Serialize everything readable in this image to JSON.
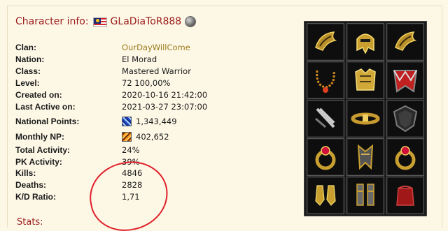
{
  "header": {
    "label": "Character info:",
    "name": "GLaDiaToR888"
  },
  "info": [
    {
      "key": "Clan:",
      "value": "OurDayWillCome",
      "link": true
    },
    {
      "key": "Nation:",
      "value": "El Morad"
    },
    {
      "key": "Class:",
      "value": "Mastered Warrior"
    },
    {
      "key": "Level:",
      "value": "72 100,00%"
    },
    {
      "key": "Created on:",
      "value": "2020-10-16 21:42:00"
    },
    {
      "key": "Last Active on:",
      "value": "2021-03-27 23:07:00"
    },
    {
      "key": "National Points:",
      "value": "1,343,449",
      "icon": "national-points-icon"
    },
    {
      "key": "Monthly NP:",
      "value": "402,652",
      "icon": "monthly-np-icon"
    },
    {
      "key": "Total Activity:",
      "value": "24%"
    },
    {
      "key": "PK Activity:",
      "value": "39%"
    },
    {
      "key": "Kills:",
      "value": "4846"
    },
    {
      "key": "Deaths:",
      "value": "2828"
    },
    {
      "key": "K/D Ratio:",
      "value": "1,71"
    }
  ],
  "stats_label": "Stats:",
  "colors": {
    "header_red": "#9a1a1a",
    "clan_link": "#9a7a1a",
    "annotation_red": "#e0202a",
    "background": "#fdf8e6"
  },
  "inventory": [
    "shoulder-left-icon",
    "helmet-icon",
    "shoulder-right-icon",
    "necklace-icon",
    "chest-armor-icon",
    "cape-icon",
    "weapon-right-icon",
    "belt-icon",
    "shield-icon",
    "ring-left-icon",
    "gauntlet-icon",
    "ring-right-icon",
    "gloves-icon",
    "boots-icon",
    "pouch-icon"
  ]
}
